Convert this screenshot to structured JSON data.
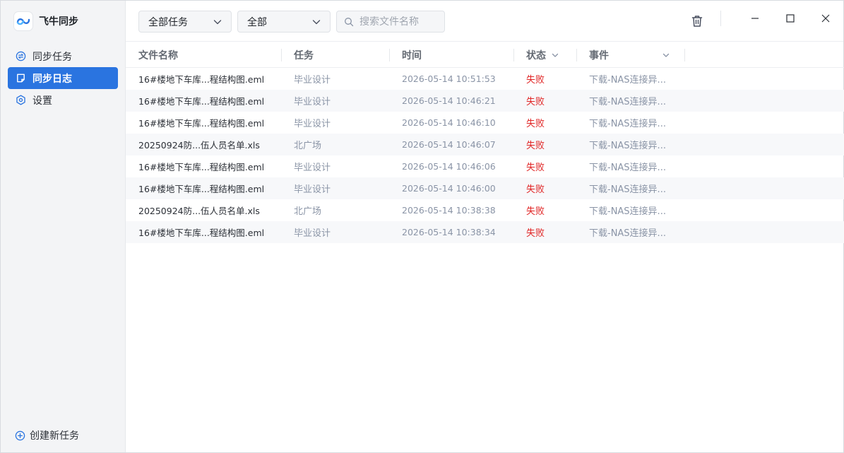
{
  "app": {
    "title": "飞牛同步"
  },
  "sidebar": {
    "items": [
      {
        "label": "同步任务",
        "icon": "sync-icon",
        "active": false
      },
      {
        "label": "同步日志",
        "icon": "log-icon",
        "active": true
      },
      {
        "label": "设置",
        "icon": "gear-icon",
        "active": false
      }
    ],
    "create_label": "创建新任务"
  },
  "toolbar": {
    "task_filter": "全部任务",
    "status_filter": "全部",
    "search_placeholder": "搜索文件名称"
  },
  "table": {
    "columns": {
      "name": "文件名称",
      "task": "任务",
      "time": "时间",
      "status": "状态",
      "event": "事件"
    },
    "rows": [
      {
        "name": "16#楼地下车库...程结构图.eml",
        "task": "毕业设计",
        "time": "2026-05-14 10:51:53",
        "status": "失败",
        "event": "下载-NAS连接异..."
      },
      {
        "name": "16#楼地下车库...程结构图.eml",
        "task": "毕业设计",
        "time": "2026-05-14 10:46:21",
        "status": "失败",
        "event": "下载-NAS连接异..."
      },
      {
        "name": "16#楼地下车库...程结构图.eml",
        "task": "毕业设计",
        "time": "2026-05-14 10:46:10",
        "status": "失败",
        "event": "下载-NAS连接异..."
      },
      {
        "name": "20250924防...伍人员名单.xls",
        "task": "北广场",
        "time": "2026-05-14 10:46:07",
        "status": "失败",
        "event": "下载-NAS连接异..."
      },
      {
        "name": "16#楼地下车库...程结构图.eml",
        "task": "毕业设计",
        "time": "2026-05-14 10:46:06",
        "status": "失败",
        "event": "下载-NAS连接异..."
      },
      {
        "name": "16#楼地下车库...程结构图.eml",
        "task": "毕业设计",
        "time": "2026-05-14 10:46:00",
        "status": "失败",
        "event": "下载-NAS连接异..."
      },
      {
        "name": "20250924防...伍人员名单.xls",
        "task": "北广场",
        "time": "2026-05-14 10:38:38",
        "status": "失败",
        "event": "下载-NAS连接异..."
      },
      {
        "name": "16#楼地下车库...程结构图.eml",
        "task": "毕业设计",
        "time": "2026-05-14 10:38:34",
        "status": "失败",
        "event": "下载-NAS连接异..."
      }
    ]
  },
  "colors": {
    "accent": "#2a74e0",
    "status_fail": "#e02424"
  }
}
